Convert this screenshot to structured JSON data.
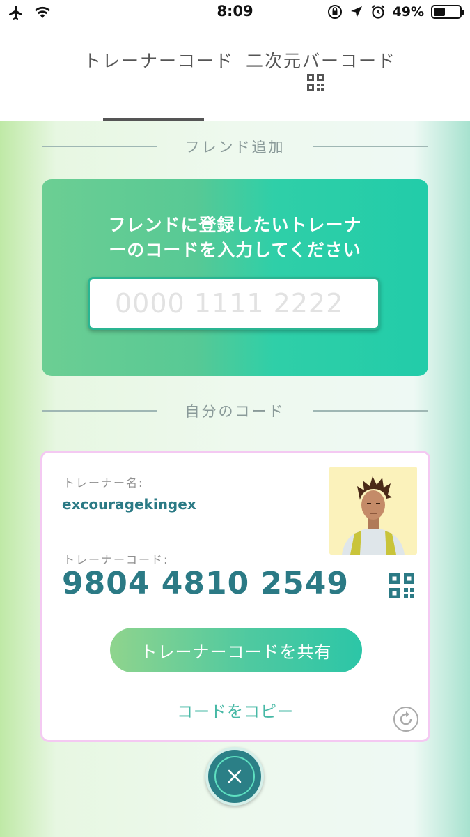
{
  "status_bar": {
    "time": "8:09",
    "battery_percent": "49%",
    "battery_level": 0.49
  },
  "tabs": [
    {
      "label": "トレーナーコード",
      "active": true
    },
    {
      "label": "二次元バーコード",
      "active": false
    }
  ],
  "friend_add": {
    "section_label": "フレンド追加",
    "title_line1": "フレンドに登録したいトレーナ",
    "title_line2": "ーのコードを入力してください",
    "input_placeholder": "0000 1111 2222",
    "input_value": ""
  },
  "my_code": {
    "section_label": "自分のコード",
    "name_label": "トレーナー名:",
    "trainer_name": "excouragekingex",
    "code_label": "トレーナーコード:",
    "trainer_code": "9804 4810 2549",
    "share_label": "トレーナーコードを共有",
    "copy_label": "コードをコピー"
  },
  "colors": {
    "accent_teal": "#2b7a85",
    "card_border_pink": "#f4c9f2",
    "friend_card_green": "#22cca9"
  }
}
